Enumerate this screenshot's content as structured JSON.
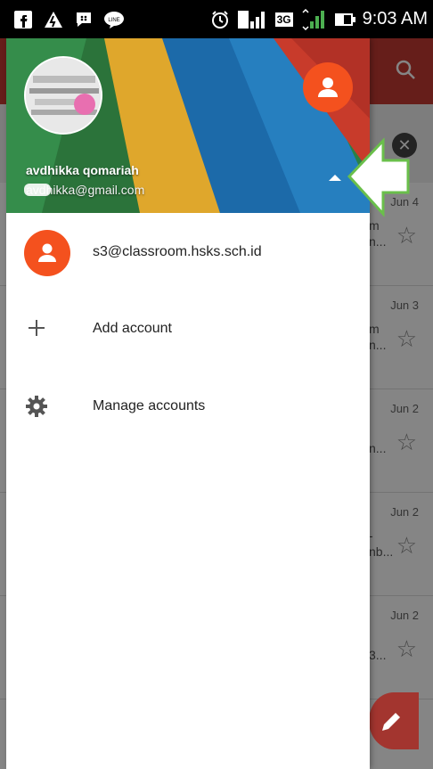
{
  "status_bar": {
    "time": "9:03 AM",
    "network": "3G",
    "icons": [
      "facebook-icon",
      "alert-icon",
      "bbm-icon",
      "line-icon",
      "alarm-icon",
      "signal-icon",
      "battery-icon"
    ]
  },
  "drawer": {
    "account_name": "avdhikka qomariah",
    "account_email": "avdhikka@gmail.com",
    "items": [
      {
        "label": "s3@classroom.hsks.sch.id",
        "icon": "account-avatar-icon"
      },
      {
        "label": "Add account",
        "icon": "plus-icon"
      },
      {
        "label": "Manage accounts",
        "icon": "gear-icon"
      }
    ]
  },
  "background_list": {
    "rows": [
      {
        "date": "Jun 4",
        "snip1": "m",
        "snip2": "n..."
      },
      {
        "date": "Jun 3",
        "snip1": "m",
        "snip2": "n..."
      },
      {
        "date": "Jun 2",
        "snip1": "",
        "snip2": "n..."
      },
      {
        "date": "Jun 2",
        "snip1": "-",
        "snip2": "nb..."
      },
      {
        "date": "Jun 2",
        "snip1": "",
        "snip2": "3..."
      }
    ]
  },
  "colors": {
    "accent": "#f4511e",
    "appbar": "#c33b33",
    "annotation_arrow": "#6abf4b"
  }
}
